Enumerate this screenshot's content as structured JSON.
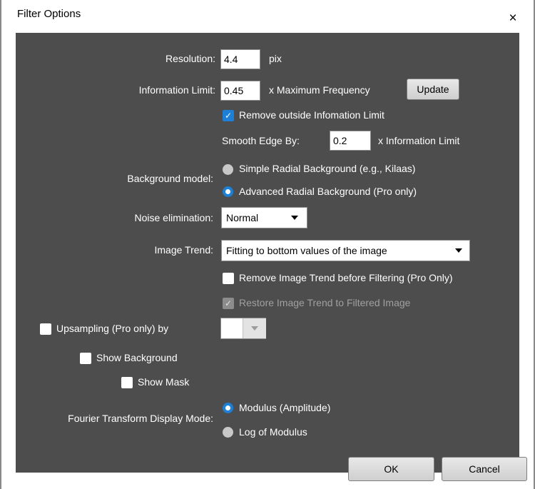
{
  "window": {
    "title": "Filter Options",
    "close_glyph": "×"
  },
  "resolution": {
    "label": "Resolution:",
    "value": "4.4",
    "unit": "pix"
  },
  "info_limit": {
    "label": "Information Limit:",
    "value": "0.45",
    "unit": "x Maximum Frequency",
    "update_label": "Update"
  },
  "remove_outside": {
    "label": "Remove outside Infomation Limit",
    "checked": true
  },
  "smooth_edge": {
    "label": "Smooth Edge By:",
    "value": "0.2",
    "unit": "x Information Limit"
  },
  "background_model": {
    "label": "Background model:",
    "options": [
      {
        "label": "Simple Radial Background (e.g., Kilaas)",
        "selected": false
      },
      {
        "label": "Advanced Radial Background (Pro only)",
        "selected": true
      }
    ]
  },
  "noise": {
    "label": "Noise elimination:",
    "value": "Normal"
  },
  "image_trend": {
    "label": "Image Trend:",
    "value": "Fitting to bottom values of the image"
  },
  "remove_trend": {
    "label": "Remove Image Trend before Filtering (Pro Only)",
    "checked": false
  },
  "restore_trend": {
    "label": "Restore Image Trend to Filtered Image",
    "checked": true,
    "disabled": true
  },
  "upsampling": {
    "label": "Upsampling (Pro only) by",
    "checked": false,
    "value": ""
  },
  "show_background": {
    "label": "Show Background",
    "checked": false
  },
  "show_mask": {
    "label": "Show Mask",
    "checked": false
  },
  "ft_display": {
    "label": "Fourier Transform  Display Mode:",
    "options": [
      {
        "label": "Modulus (Amplitude)",
        "selected": true
      },
      {
        "label": "Log of Modulus",
        "selected": false
      }
    ]
  },
  "buttons": {
    "ok": "OK",
    "cancel": "Cancel"
  },
  "colors": {
    "panel": "#4d4d4d",
    "accent": "#1e7fd6",
    "text": "#ffffff"
  },
  "icons": {
    "check": "check-icon",
    "close": "close-icon",
    "dropdown": "chevron-down-icon"
  }
}
